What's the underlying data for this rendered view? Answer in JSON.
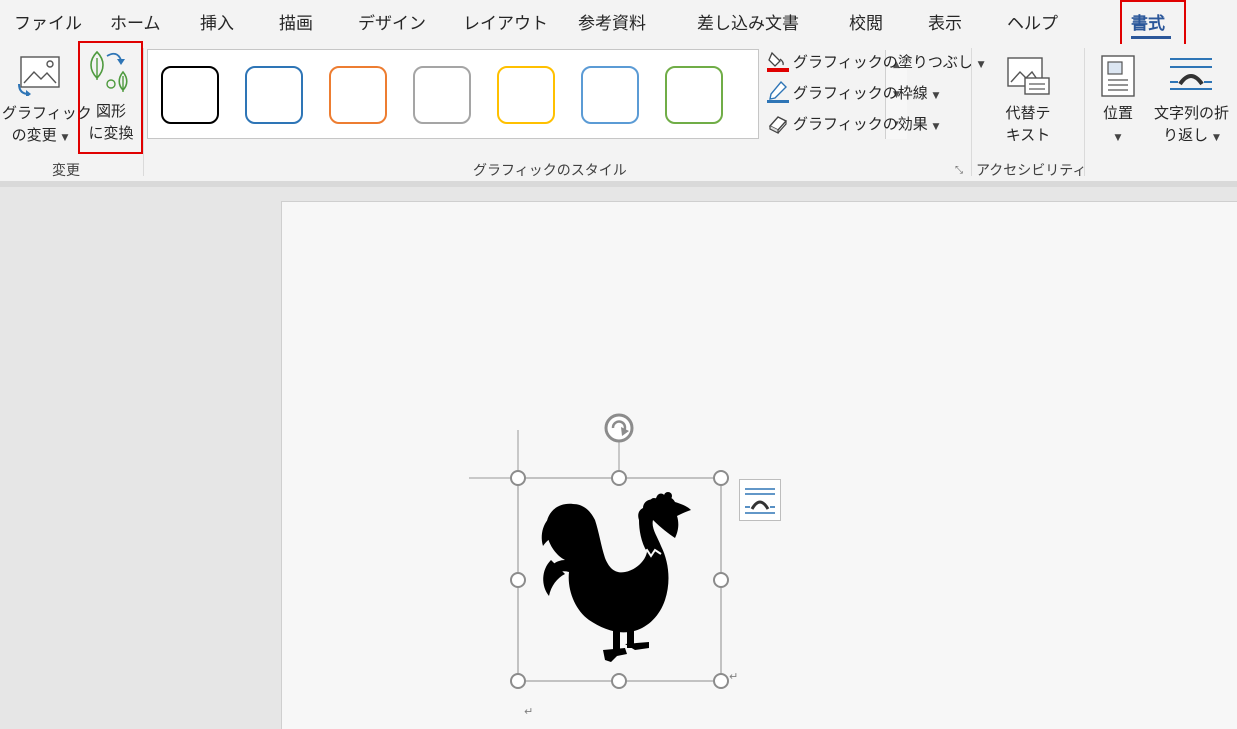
{
  "tabs": {
    "file": "ファイル",
    "home": "ホーム",
    "insert": "挿入",
    "draw": "描画",
    "design": "デザイン",
    "layout": "レイアウト",
    "references": "参考資料",
    "mailings": "差し込み文書",
    "review": "校閲",
    "view": "表示",
    "help": "ヘルプ",
    "format": "書式"
  },
  "ribbon": {
    "change_group": {
      "label": "変更",
      "change_graphic_line1": "グラフィック",
      "change_graphic_line2": "の変更",
      "convert_shape_line1": "図形",
      "convert_shape_line2": "に変換"
    },
    "styles_group": {
      "label": "グラフィックのスタイル",
      "swatch_colors": [
        "#000000",
        "#2e75b6",
        "#ed7d31",
        "#a5a5a5",
        "#ffc000",
        "#5b9bd5",
        "#70ad47"
      ],
      "fill": "グラフィックの塗りつぶし",
      "outline": "グラフィックの枠線",
      "effects": "グラフィックの効果"
    },
    "accessibility_group": {
      "label": "アクセシビリティ",
      "alt_text_line1": "代替テ",
      "alt_text_line2": "キスト"
    },
    "arrange_group": {
      "position": "位置",
      "wrap_line1": "文字列の折",
      "wrap_line2": "り返し"
    }
  },
  "colors": {
    "accent": "#2b579a",
    "highlight": "#e00000"
  },
  "icons": {
    "graphic": "rooster-icon",
    "layout_options": "layout-options-icon",
    "rotate": "rotate-handle-icon"
  }
}
